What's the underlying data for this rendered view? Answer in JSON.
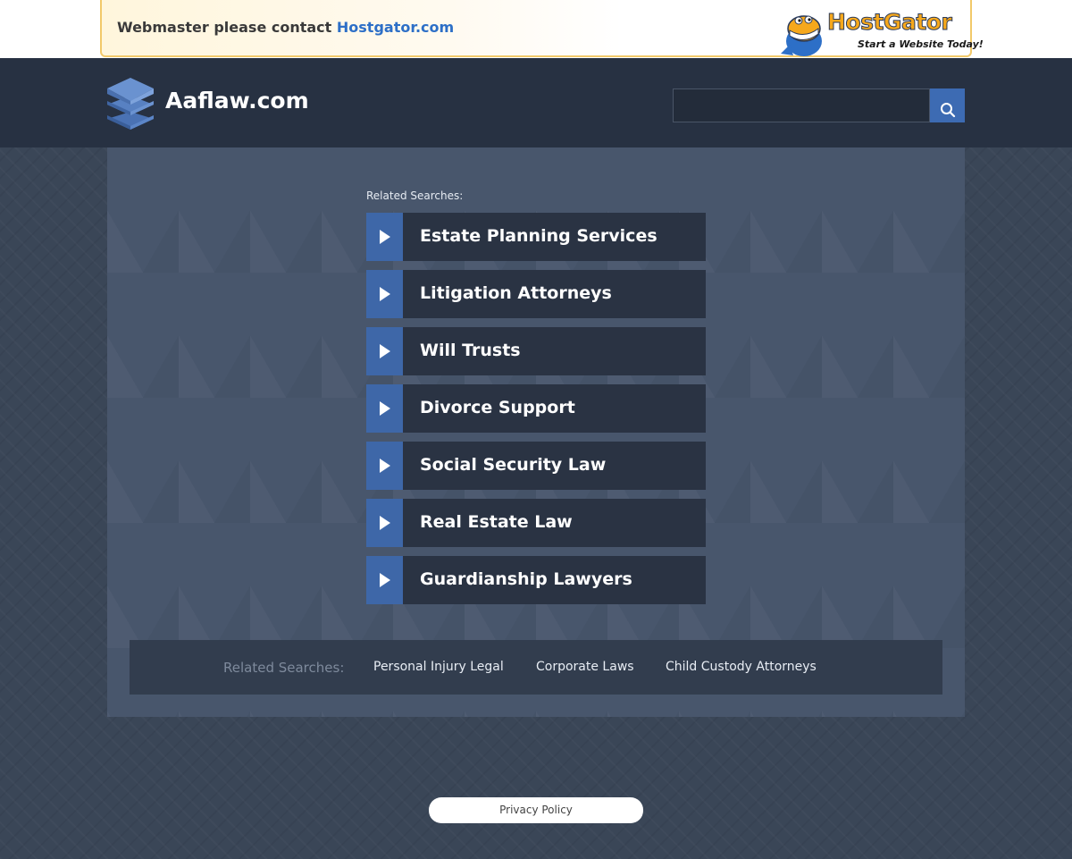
{
  "banner": {
    "text": "Webmaster please contact",
    "link": "Hostgator.com",
    "ad_title": "HostGator",
    "ad_tagline": "Start a Website Today!"
  },
  "header": {
    "site_name": "Aaflaw.com",
    "search": {
      "value": "",
      "placeholder": ""
    }
  },
  "related_searches": {
    "title": "Related Searches:",
    "items": [
      {
        "label": "Estate Planning Services"
      },
      {
        "label": "Litigation Attorneys"
      },
      {
        "label": "Will Trusts"
      },
      {
        "label": "Divorce Support"
      },
      {
        "label": "Social Security Law"
      },
      {
        "label": "Real Estate Law"
      },
      {
        "label": "Guardianship Lawyers"
      }
    ]
  },
  "bottom_related": {
    "title": "Related Searches:",
    "links": [
      "Personal Injury Legal",
      "Corporate Laws",
      "Child Custody Attorneys"
    ]
  },
  "footer": {
    "privacy_label": "Privacy Policy"
  },
  "colors": {
    "accent_blue": "#3e67a8",
    "header_bg": "#273142",
    "banner_link": "#2d6fc7",
    "hostgator_orange": "#f6a81c"
  },
  "icons": {
    "search": "magnifier-icon",
    "arrow": "play-arrow-icon",
    "logo": "stacked-layers-icon"
  }
}
